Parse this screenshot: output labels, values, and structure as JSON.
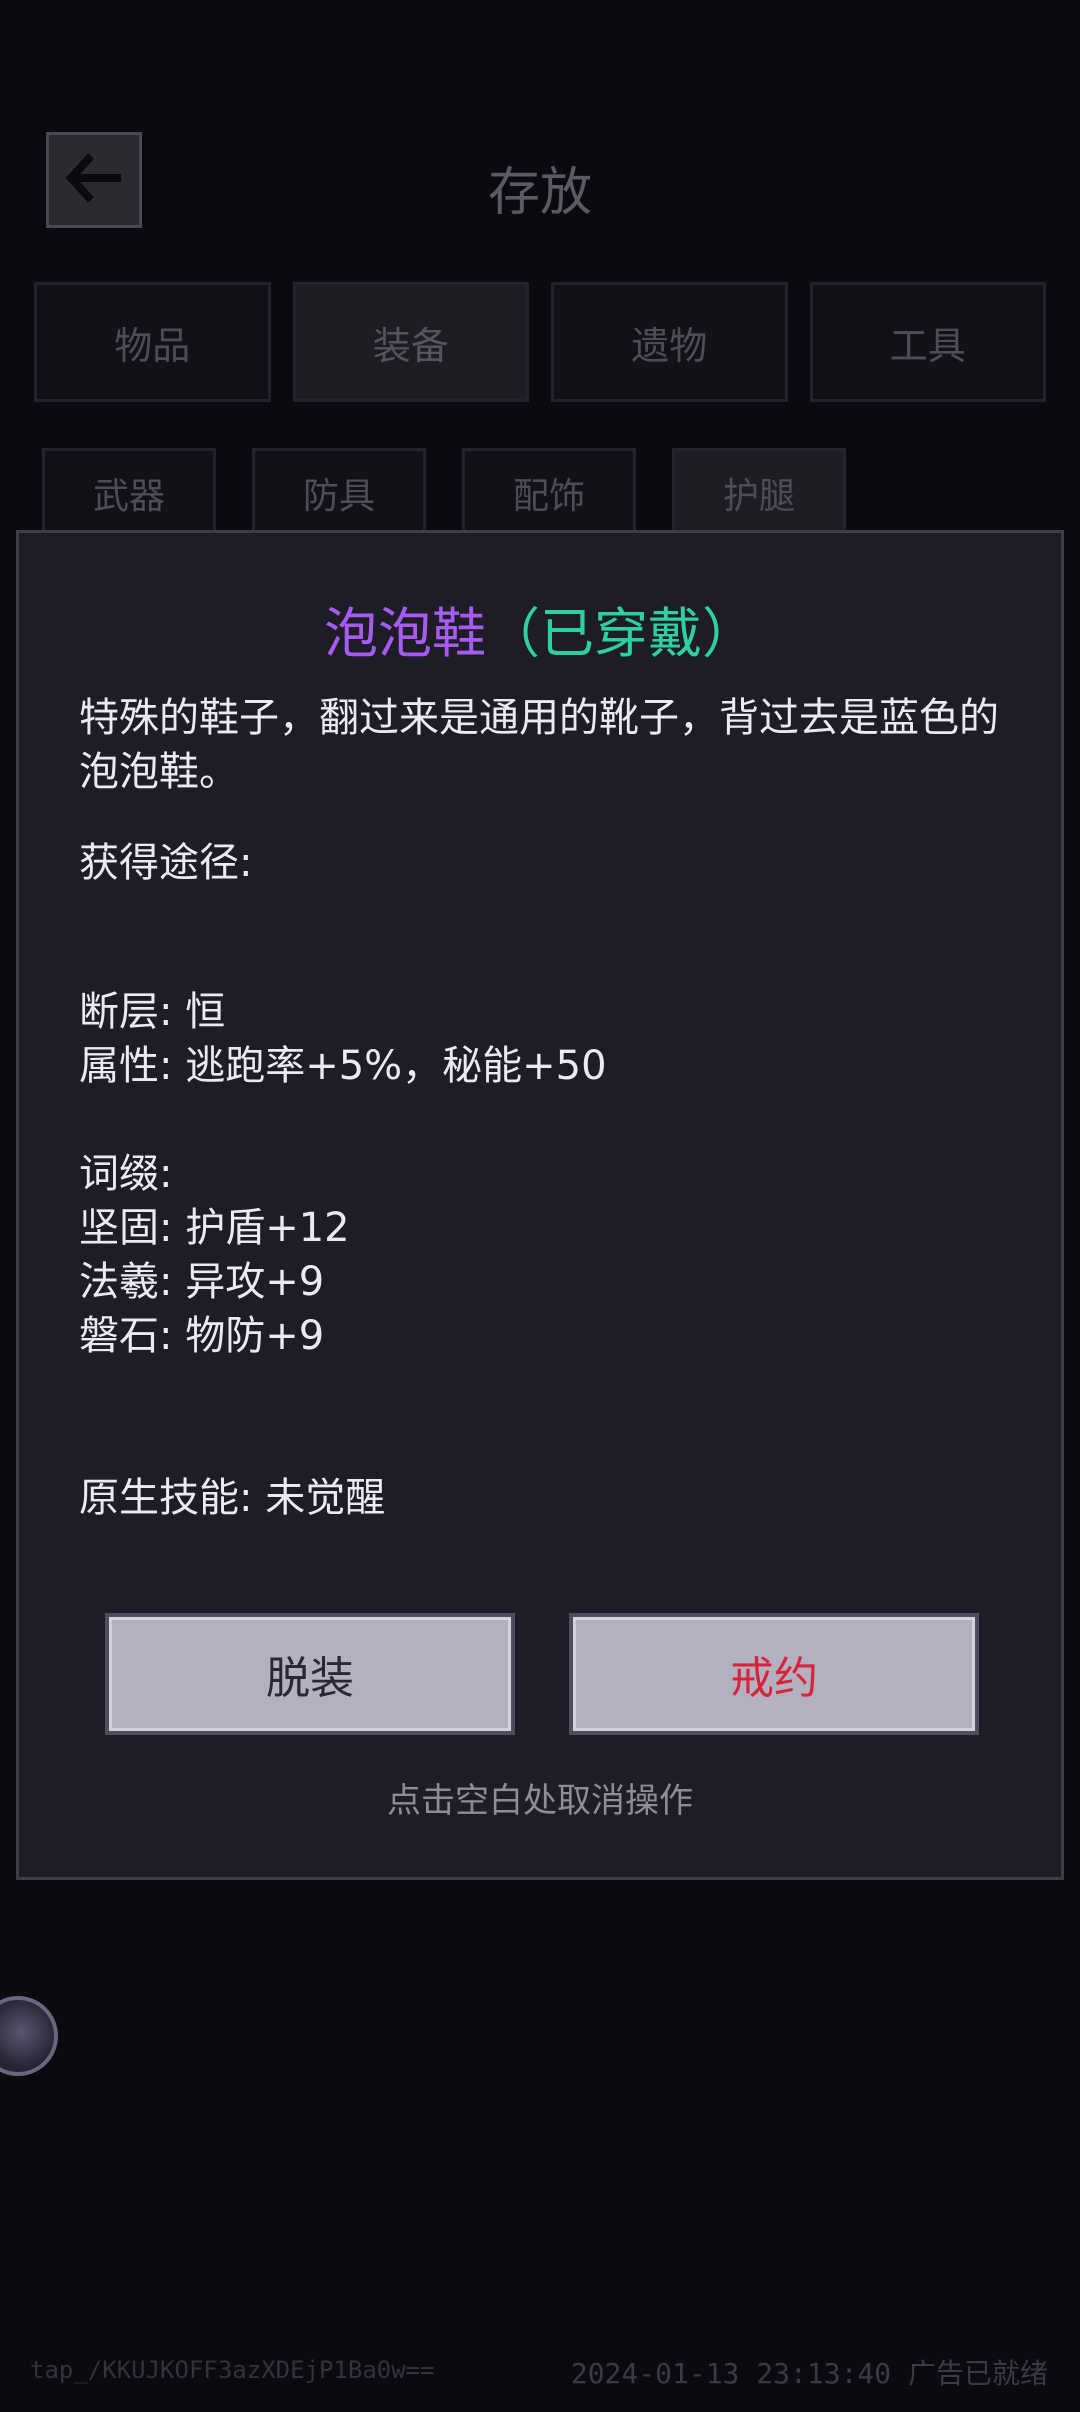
{
  "header": {
    "title": "存放"
  },
  "tabs_main": [
    "物品",
    "装备",
    "遗物",
    "工具"
  ],
  "tabs_sub": [
    "武器",
    "防具",
    "配饰",
    "护腿"
  ],
  "modal": {
    "item_name": "泡泡鞋",
    "item_status": "（已穿戴）",
    "description": "特殊的鞋子，翻过来是通用的靴子，背过去是蓝色的泡泡鞋。",
    "source_label": "获得途径:",
    "tier": "断层: 恒",
    "attributes": "属性: 逃跑率+5%，秘能+50",
    "affix_header": "词缀:",
    "affixes": [
      "坚固: 护盾+12",
      "法羲: 异攻+9",
      "磐石: 物防+9"
    ],
    "native_skill": "原生技能: 未觉醒",
    "buttons": {
      "unequip": "脱装",
      "contract": "戒约"
    },
    "hint": "点击空白处取消操作"
  },
  "footer": {
    "id_text": "tap_/KKUJKOFF3azXDEjP1Ba0w==",
    "status_text": "2024-01-13 23:13:40 广告已就绪"
  },
  "colors": {
    "item_name": "#a65bf2",
    "item_status": "#2ed0a3",
    "contract_button_text": "#d8243a"
  }
}
